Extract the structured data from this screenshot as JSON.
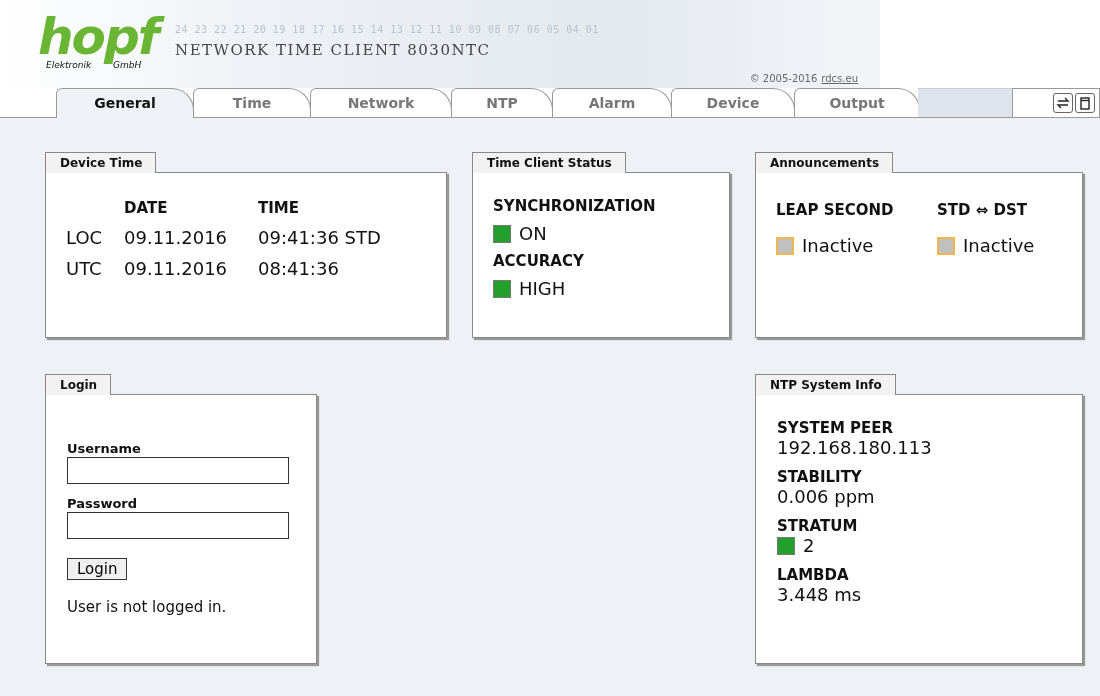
{
  "header": {
    "logo": "hopf",
    "logo_left": "Elektronik",
    "logo_right": "GmbH",
    "scale": "24 23 22 21 20 19 18 17 16 15 14 13 12 11 10 09 08 07 06 05 04 01",
    "title": "NETWORK TIME CLIENT 8030NTC",
    "copyright": "© 2005-2016",
    "copyright_link": "rdcs.eu"
  },
  "tabs": [
    {
      "label": "General",
      "selected": true
    },
    {
      "label": "Time",
      "selected": false
    },
    {
      "label": "Network",
      "selected": false
    },
    {
      "label": "NTP",
      "selected": false
    },
    {
      "label": "Alarm",
      "selected": false
    },
    {
      "label": "Device",
      "selected": false
    },
    {
      "label": "Output",
      "selected": false
    }
  ],
  "device_time": {
    "title": "Device Time",
    "columns": [
      "DATE",
      "TIME"
    ],
    "rows": [
      {
        "label": "LOC",
        "date": "09.11.2016",
        "time": "09:41:36 STD"
      },
      {
        "label": "UTC",
        "date": "09.11.2016",
        "time": "08:41:36"
      }
    ]
  },
  "time_client_status": {
    "title": "Time Client Status",
    "items": [
      {
        "label": "SYNCHRONIZATION",
        "value": "ON",
        "color": "#22a02a"
      },
      {
        "label": "ACCURACY",
        "value": "HIGH",
        "color": "#22a02a"
      }
    ]
  },
  "announcements": {
    "title": "Announcements",
    "items": [
      {
        "label": "LEAP SECOND",
        "value": "Inactive",
        "color": "#c0c0c0"
      },
      {
        "label": "STD ⇔ DST",
        "value": "Inactive",
        "color": "#c0c0c0"
      }
    ]
  },
  "login": {
    "title": "Login",
    "username_label": "Username",
    "password_label": "Password",
    "button": "Login",
    "message": "User is not logged in."
  },
  "ntp_system_info": {
    "title": "NTP System Info",
    "items": [
      {
        "label": "SYSTEM PEER",
        "value": "192.168.180.113",
        "kind": "text"
      },
      {
        "label": "STABILITY",
        "value": "0.006 ppm",
        "kind": "text"
      },
      {
        "label": "STRATUM",
        "value": "2",
        "kind": "indicator",
        "color": "#22a02a"
      },
      {
        "label": "LAMBDA",
        "value": "3.448 ms",
        "kind": "text"
      }
    ]
  }
}
